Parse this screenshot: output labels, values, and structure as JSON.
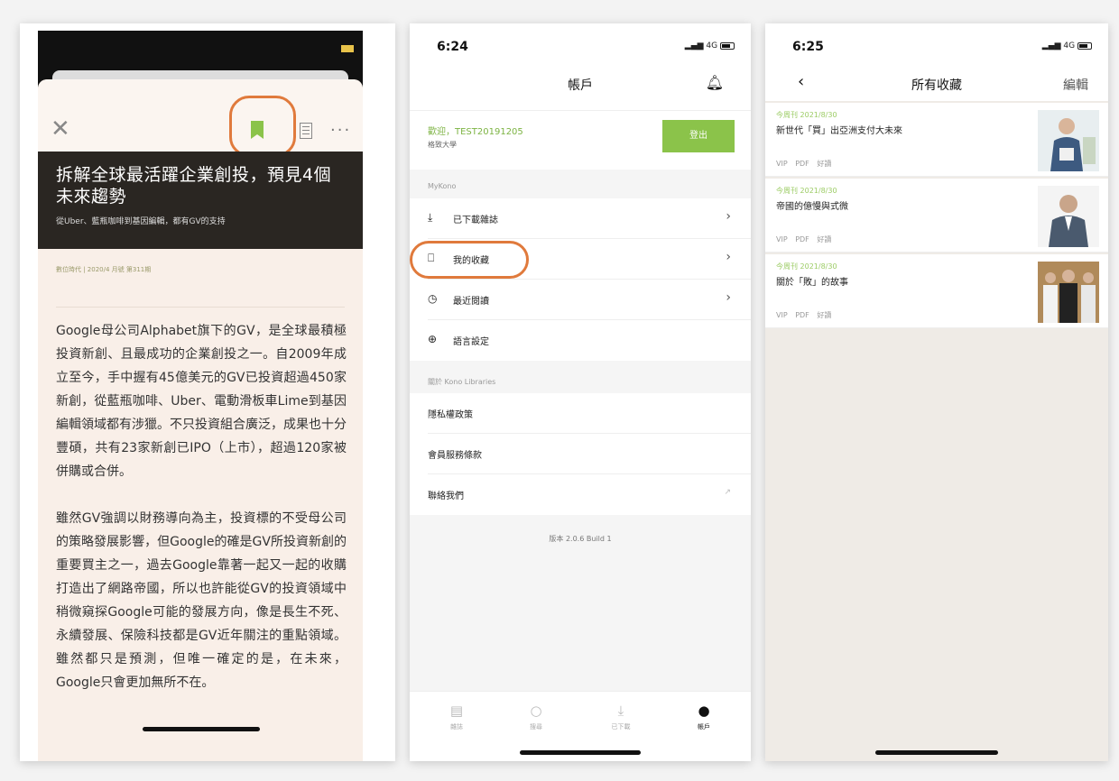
{
  "phone1": {
    "title": "拆解全球最活躍企業創投，預見4個未來趨勢",
    "subtitle": "從Uber、藍瓶咖啡到基因編輯，都有GV的支持",
    "meta": "數位時代 | 2020/4 月號 第311期",
    "paragraphs": [
      "Google母公司Alphabet旗下的GV，是全球最積極投資新創、且最成功的企業創投之一。自2009年成立至今，手中握有45億美元的GV已投資超過450家新創，從藍瓶咖啡、Uber、電動滑板車Lime到基因編輯領域都有涉獵。不只投資組合廣泛，成果也十分豐碩，共有23家新創已IPO（上市），超過120家被併購或合併。",
      "雖然GV強調以財務導向為主，投資標的不受母公司的策略發展影響，但Google的確是GV所投資新創的重要買主之一，過去Google靠著一起又一起的收購打造出了網路帝國，所以也許能從GV的投資領域中稍微窺探Google可能的發展方向，像是長生不死、永續發展、保險科技都是GV近年關注的重點領域。雖然都只是預測，但唯一確定的是，在未來，Google只會更加無所不在。"
    ]
  },
  "phone2": {
    "time": "6:24",
    "network": "4G",
    "header_title": "帳戶",
    "greeting": "歡迎，TEST20191205",
    "school": "格致大學",
    "logout_label": "登出",
    "section1_label": "MyKono",
    "menu1": [
      {
        "icon": "download-icon",
        "label": "已下載雜誌"
      },
      {
        "icon": "bookmark-icon",
        "label": "我的收藏"
      },
      {
        "icon": "clock-icon",
        "label": "最近閱讀"
      },
      {
        "icon": "globe-icon",
        "label": "語言設定"
      }
    ],
    "section2_label": "關於 Kono Libraries",
    "menu2": [
      {
        "label": "隱私權政策"
      },
      {
        "label": "會員服務條款"
      },
      {
        "label": "聯絡我們"
      }
    ],
    "version": "版本 2.0.6 Build 1",
    "tabs": [
      {
        "icon": "magazine-icon",
        "label": "雜誌"
      },
      {
        "icon": "search-icon",
        "label": "搜尋"
      },
      {
        "icon": "download-icon",
        "label": "已下載"
      },
      {
        "icon": "account-icon",
        "label": "帳戶"
      }
    ]
  },
  "phone3": {
    "time": "6:25",
    "network": "4G",
    "title": "所有收藏",
    "edit_label": "編輯",
    "back_icon": "chevron-left-icon",
    "favorites": [
      {
        "source": "今周刊 2021/8/30",
        "title": "新世代「買」出亞洲支付大未來",
        "tags": "VIP PDF 好讀"
      },
      {
        "source": "今周刊 2021/8/30",
        "title": "帝國的億慢與式微",
        "tags": "VIP PDF 好讀"
      },
      {
        "source": "今周刊 2021/8/30",
        "title": "關於「敗」的故事",
        "tags": "VIP PDF 好讀"
      }
    ]
  },
  "colors": {
    "accent": "#8bc34a",
    "highlight": "#e07a3c"
  }
}
